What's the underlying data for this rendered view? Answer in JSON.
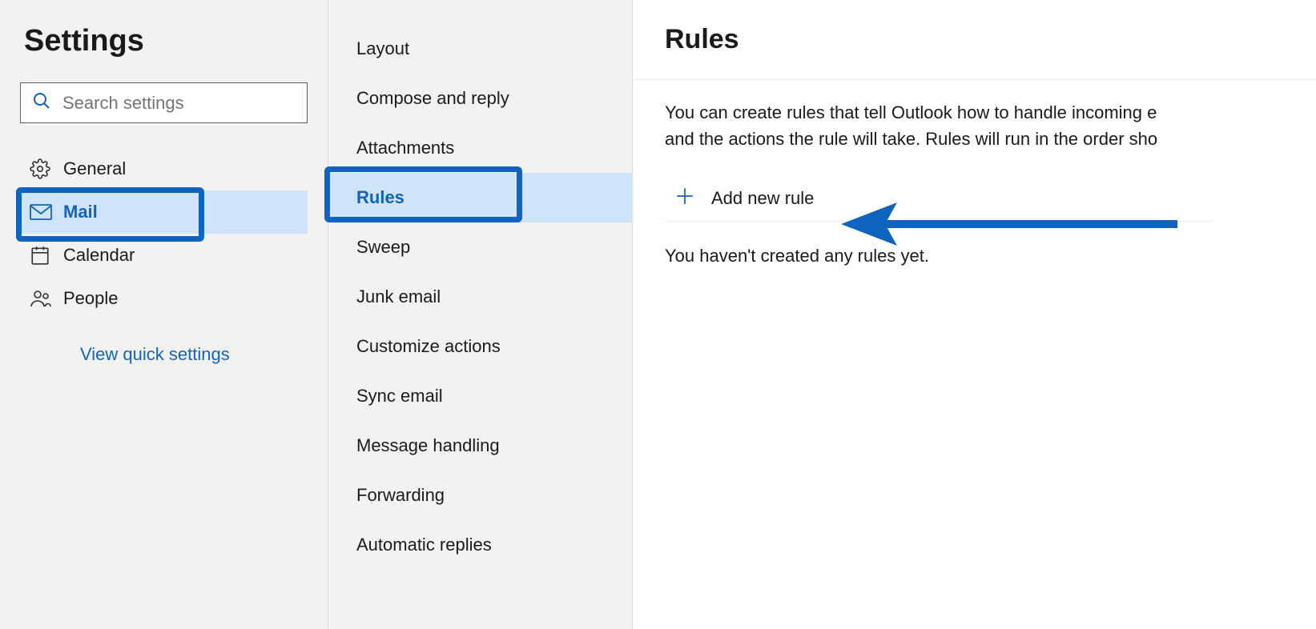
{
  "page": {
    "title": "Settings"
  },
  "search": {
    "placeholder": "Search settings"
  },
  "sidebar": {
    "items": [
      {
        "label": "General"
      },
      {
        "label": "Mail"
      },
      {
        "label": "Calendar"
      },
      {
        "label": "People"
      }
    ],
    "quick_link": "View quick settings"
  },
  "subnav": {
    "items": [
      {
        "label": "Layout"
      },
      {
        "label": "Compose and reply"
      },
      {
        "label": "Attachments"
      },
      {
        "label": "Rules"
      },
      {
        "label": "Sweep"
      },
      {
        "label": "Junk email"
      },
      {
        "label": "Customize actions"
      },
      {
        "label": "Sync email"
      },
      {
        "label": "Message handling"
      },
      {
        "label": "Forwarding"
      },
      {
        "label": "Automatic replies"
      }
    ]
  },
  "content": {
    "title": "Rules",
    "description_line1": "You can create rules that tell Outlook how to handle incoming e",
    "description_line2": "and the actions the rule will take. Rules will run in the order sho",
    "add_button": "Add new rule",
    "empty_state": "You haven't created any rules yet."
  }
}
